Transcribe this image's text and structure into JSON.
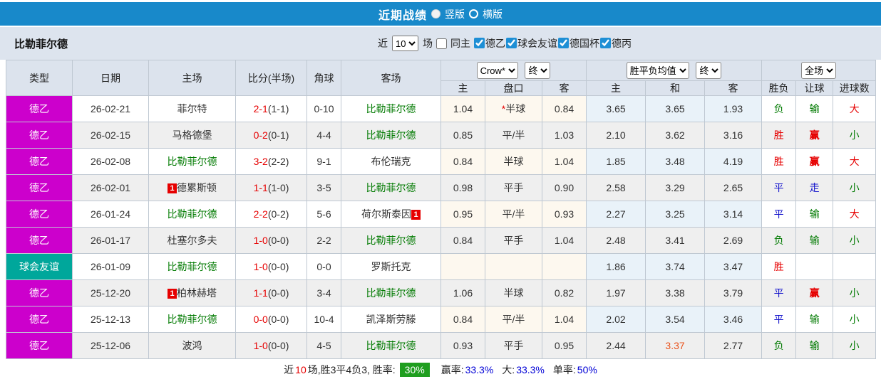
{
  "colors": {
    "green": "#007a00",
    "red": "#e60000",
    "blue": "#1414cc",
    "black": "#343434",
    "orange": "#e9531d",
    "magenta": "#cc00cc",
    "teal": "#00a79b",
    "titlebar_blue": "#1889ca",
    "badge_green": "#1f9e1f",
    "link_blue": "#0000d6"
  },
  "titlebar": {
    "title": "近期战绩",
    "radio_vertical": "竖版",
    "radio_horizontal": "横版",
    "selected_layout": "竖版"
  },
  "filter": {
    "team": "比勒菲尔德",
    "near_label": "近",
    "match_count": "10",
    "games_label": "场",
    "same_home_label": "同主",
    "same_home_checked": false,
    "leagues": [
      {
        "label": "德乙",
        "checked": true
      },
      {
        "label": "球会友谊",
        "checked": true
      },
      {
        "label": "德国杯",
        "checked": true
      },
      {
        "label": "德丙",
        "checked": true
      }
    ]
  },
  "selectors": {
    "company": "Crow*",
    "company_state": "终",
    "odds_type": "胜平负均值",
    "odds_state": "终",
    "scope": "全场"
  },
  "columns": {
    "type": "类型",
    "date": "日期",
    "home": "主场",
    "score": "比分(半场)",
    "corner": "角球",
    "away": "客场",
    "sub_home": "主",
    "sub_handicap": "盘口",
    "sub_away": "客",
    "sub_win": "主",
    "sub_draw": "和",
    "sub_lose": "客",
    "sub_result": "胜负",
    "sub_handicap_result": "让球",
    "sub_goals": "进球数"
  },
  "rows": [
    {
      "league": "德乙",
      "league_color": "magenta",
      "date": "26-02-21",
      "home": {
        "name": "菲尔特",
        "color": "black"
      },
      "score_full": "2-1",
      "score_half": "(1-1)",
      "corner": "0-10",
      "away": {
        "name": "比勒菲尔德",
        "color": "green"
      },
      "ah_home": "1.04",
      "ah_line": "*半球",
      "ah_away": "0.84",
      "o_win": "3.65",
      "o_draw": "3.65",
      "o_lose": "1.93",
      "result": {
        "text": "负",
        "color": "green"
      },
      "ah_result": {
        "text": "输",
        "color": "green"
      },
      "goals": {
        "text": "大",
        "color": "red"
      }
    },
    {
      "league": "德乙",
      "league_color": "magenta",
      "date": "26-02-15",
      "home": {
        "name": "马格德堡",
        "color": "black"
      },
      "score_full": "0-2",
      "score_half": "(0-1)",
      "corner": "4-4",
      "away": {
        "name": "比勒菲尔德",
        "color": "green"
      },
      "ah_home": "0.85",
      "ah_line": "平/半",
      "ah_away": "1.03",
      "o_win": "2.10",
      "o_draw": "3.62",
      "o_lose": "3.16",
      "result": {
        "text": "胜",
        "color": "red"
      },
      "ah_result": {
        "text": "赢",
        "color": "red",
        "bold": true
      },
      "goals": {
        "text": "小",
        "color": "green"
      }
    },
    {
      "league": "德乙",
      "league_color": "magenta",
      "date": "26-02-08",
      "home": {
        "name": "比勒菲尔德",
        "color": "green"
      },
      "score_full": "3-2",
      "score_half": "(2-2)",
      "corner": "9-1",
      "away": {
        "name": "布伦瑞克",
        "color": "black"
      },
      "ah_home": "0.84",
      "ah_line": "半球",
      "ah_away": "1.04",
      "o_win": "1.85",
      "o_draw": "3.48",
      "o_lose": "4.19",
      "result": {
        "text": "胜",
        "color": "red"
      },
      "ah_result": {
        "text": "赢",
        "color": "red",
        "bold": true
      },
      "goals": {
        "text": "大",
        "color": "red"
      }
    },
    {
      "league": "德乙",
      "league_color": "magenta",
      "date": "26-02-01",
      "home": {
        "name": "德累斯顿",
        "color": "black",
        "badge": "1",
        "badge_pos": "before"
      },
      "score_full": "1-1",
      "score_half": "(1-0)",
      "corner": "3-5",
      "away": {
        "name": "比勒菲尔德",
        "color": "green"
      },
      "ah_home": "0.98",
      "ah_line": "平手",
      "ah_away": "0.90",
      "o_win": "2.58",
      "o_draw": "3.29",
      "o_lose": "2.65",
      "result": {
        "text": "平",
        "color": "blue"
      },
      "ah_result": {
        "text": "走",
        "color": "blue"
      },
      "goals": {
        "text": "小",
        "color": "green"
      }
    },
    {
      "league": "德乙",
      "league_color": "magenta",
      "date": "26-01-24",
      "home": {
        "name": "比勒菲尔德",
        "color": "green"
      },
      "score_full": "2-2",
      "score_half": "(0-2)",
      "corner": "5-6",
      "away": {
        "name": "荷尔斯泰因",
        "color": "black",
        "badge": "1",
        "badge_pos": "after"
      },
      "ah_home": "0.95",
      "ah_line": "平/半",
      "ah_away": "0.93",
      "o_win": "2.27",
      "o_draw": "3.25",
      "o_lose": "3.14",
      "result": {
        "text": "平",
        "color": "blue"
      },
      "ah_result": {
        "text": "输",
        "color": "green"
      },
      "goals": {
        "text": "大",
        "color": "red"
      }
    },
    {
      "league": "德乙",
      "league_color": "magenta",
      "date": "26-01-17",
      "home": {
        "name": "杜塞尔多夫",
        "color": "black"
      },
      "score_full": "1-0",
      "score_half": "(0-0)",
      "corner": "2-2",
      "away": {
        "name": "比勒菲尔德",
        "color": "green"
      },
      "ah_home": "0.84",
      "ah_line": "平手",
      "ah_away": "1.04",
      "o_win": "2.48",
      "o_draw": "3.41",
      "o_lose": "2.69",
      "result": {
        "text": "负",
        "color": "green"
      },
      "ah_result": {
        "text": "输",
        "color": "green"
      },
      "goals": {
        "text": "小",
        "color": "green"
      }
    },
    {
      "league": "球会友谊",
      "league_color": "teal",
      "date": "26-01-09",
      "home": {
        "name": "比勒菲尔德",
        "color": "green"
      },
      "score_full": "1-0",
      "score_half": "(0-0)",
      "corner": "0-0",
      "away": {
        "name": "罗斯托克",
        "color": "black"
      },
      "ah_home": "",
      "ah_line": "",
      "ah_away": "",
      "o_win": "1.86",
      "o_draw": "3.74",
      "o_lose": "3.47",
      "result": {
        "text": "胜",
        "color": "red"
      },
      "ah_result": {
        "text": "",
        "color": "black"
      },
      "goals": {
        "text": "",
        "color": "black"
      }
    },
    {
      "league": "德乙",
      "league_color": "magenta",
      "date": "25-12-20",
      "home": {
        "name": "柏林赫塔",
        "color": "black",
        "badge": "1",
        "badge_pos": "before"
      },
      "score_full": "1-1",
      "score_half": "(0-0)",
      "corner": "3-4",
      "away": {
        "name": "比勒菲尔德",
        "color": "green"
      },
      "ah_home": "1.06",
      "ah_line": "半球",
      "ah_away": "0.82",
      "o_win": "1.97",
      "o_draw": "3.38",
      "o_lose": "3.79",
      "result": {
        "text": "平",
        "color": "blue"
      },
      "ah_result": {
        "text": "赢",
        "color": "red",
        "bold": true
      },
      "goals": {
        "text": "小",
        "color": "green"
      }
    },
    {
      "league": "德乙",
      "league_color": "magenta",
      "date": "25-12-13",
      "home": {
        "name": "比勒菲尔德",
        "color": "green"
      },
      "score_full": "0-0",
      "score_half": "(0-0)",
      "corner": "10-4",
      "away": {
        "name": "凯泽斯劳滕",
        "color": "black"
      },
      "ah_home": "0.84",
      "ah_line": "平/半",
      "ah_away": "1.04",
      "o_win": "2.02",
      "o_draw": "3.54",
      "o_lose": "3.46",
      "result": {
        "text": "平",
        "color": "blue"
      },
      "ah_result": {
        "text": "输",
        "color": "green"
      },
      "goals": {
        "text": "小",
        "color": "green"
      }
    },
    {
      "league": "德乙",
      "league_color": "magenta",
      "date": "25-12-06",
      "home": {
        "name": "波鸿",
        "color": "black"
      },
      "score_full": "1-0",
      "score_half": "(0-0)",
      "corner": "4-5",
      "away": {
        "name": "比勒菲尔德",
        "color": "green"
      },
      "ah_home": "0.93",
      "ah_line": "平手",
      "ah_away": "0.95",
      "o_win": "2.44",
      "o_draw": "3.37",
      "o_draw_color": "orange",
      "o_lose": "2.77",
      "result": {
        "text": "负",
        "color": "green"
      },
      "ah_result": {
        "text": "输",
        "color": "green"
      },
      "goals": {
        "text": "小",
        "color": "green"
      }
    }
  ],
  "footer": {
    "prefix": "近",
    "count": "10",
    "summary": "场,胜3平4负3, 胜率:",
    "win_rate": "30%",
    "win_odds_label": "赢率:",
    "win_odds_value": "33.3%",
    "big_label": "大:",
    "big_value": "33.3%",
    "single_label": "单率:",
    "single_value": "50%"
  }
}
